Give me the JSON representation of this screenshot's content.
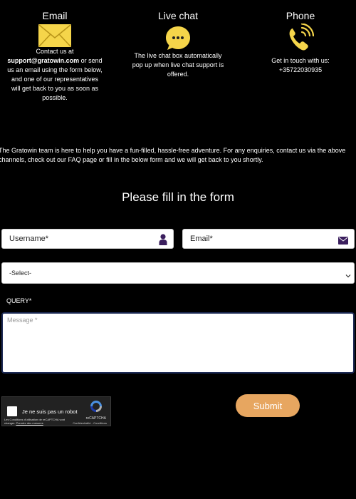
{
  "contact": {
    "email": {
      "heading": "Email",
      "text_before": "Contact us at ",
      "address": "support@gratowin.com",
      "text_after": " or send us an email using the form below, and one of our representatives will get back to you as soon as possible."
    },
    "chat": {
      "heading": "Live chat",
      "text": "The live chat box automatically pop up when live chat support is offered."
    },
    "phone": {
      "heading": "Phone",
      "text": "Get in touch with us:",
      "number": "+35722030935"
    }
  },
  "intro": "The Gratowin team is here to help you have a fun-filled, hassle-free adventure. For any enquiries, contact us via the above channels, check out our FAQ page or fill in the below form and we will get back to you shortly.",
  "form": {
    "title": "Please fill in the form",
    "username_placeholder": "Username*",
    "email_placeholder": "Email*",
    "select_value": "-Select-",
    "query_label": "QUERY*",
    "message_placeholder": "Message *",
    "submit_label": "Submit"
  },
  "recaptcha": {
    "label": "Je ne suis pas un robot",
    "brand": "reCAPTCHA",
    "links": "Confidentialité - Conditions",
    "terms_text": "Les Conditions d'utilisation de reCAPTCHA vont changer.",
    "terms_link": "Prendre des mesures"
  },
  "colors": {
    "accent_yellow": "#f5d54a",
    "submit_orange": "#e7a660",
    "icon_purple": "#3b1f5e"
  },
  "icons": {
    "email": "envelope-icon",
    "chat": "speech-bubble-icon",
    "phone": "phone-ringing-icon",
    "username": "person-icon",
    "email_field": "envelope-icon",
    "select": "chevron-down-icon"
  }
}
